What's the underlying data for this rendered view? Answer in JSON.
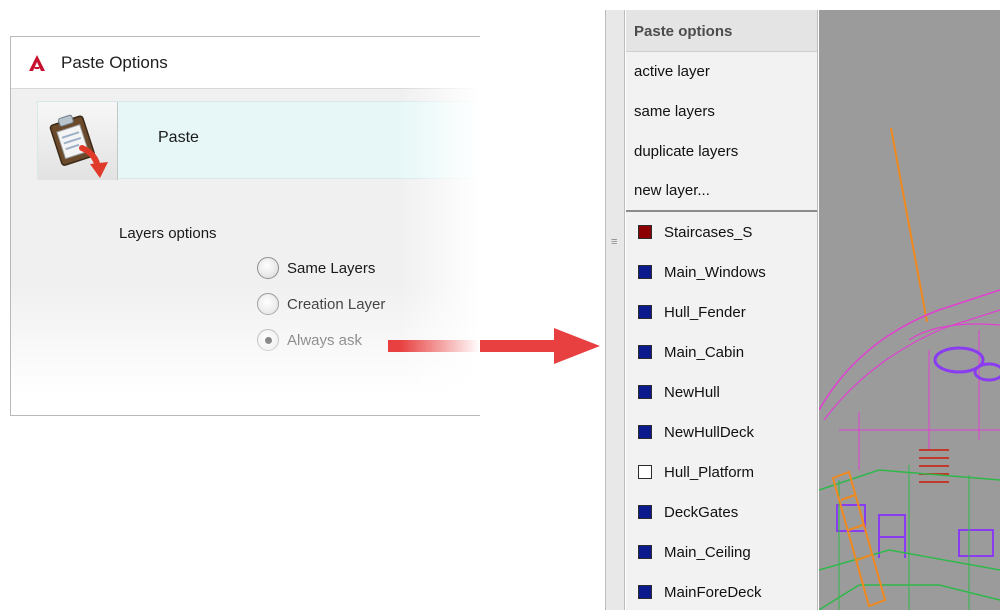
{
  "dialog": {
    "title": "Paste Options",
    "paste_label": "Paste",
    "layers_options_label": "Layers options",
    "radios": [
      {
        "label": "Same Layers",
        "selected": false
      },
      {
        "label": "Creation Layer",
        "selected": false
      },
      {
        "label": "Always ask",
        "selected": true
      }
    ]
  },
  "panel": {
    "header": "Paste options",
    "options": [
      "active layer",
      "same layers",
      "duplicate layers",
      "new layer..."
    ],
    "layers": [
      {
        "name": "Staircases_S",
        "color": "#8b0000"
      },
      {
        "name": "Main_Windows",
        "color": "#0a1a8c"
      },
      {
        "name": "Hull_Fender",
        "color": "#0a1a8c"
      },
      {
        "name": "Main_Cabin",
        "color": "#0a1a8c"
      },
      {
        "name": "NewHull",
        "color": "#0a1a8c"
      },
      {
        "name": "NewHullDeck",
        "color": "#0a1a8c"
      },
      {
        "name": "Hull_Platform",
        "color": "#ffffff"
      },
      {
        "name": "DeckGates",
        "color": "#0a1a8c"
      },
      {
        "name": "Main_Ceiling",
        "color": "#0a1a8c"
      },
      {
        "name": "MainForeDeck",
        "color": "#0a1a8c"
      }
    ]
  },
  "colors": {
    "arrow": "#e84040",
    "accent_red": "#c8102e",
    "viewport_bg": "#9b9b9b",
    "wire_magenta": "#e040d0",
    "wire_purple": "#8a3cf0",
    "wire_green": "#2fb84a",
    "wire_orange": "#f08a20"
  }
}
